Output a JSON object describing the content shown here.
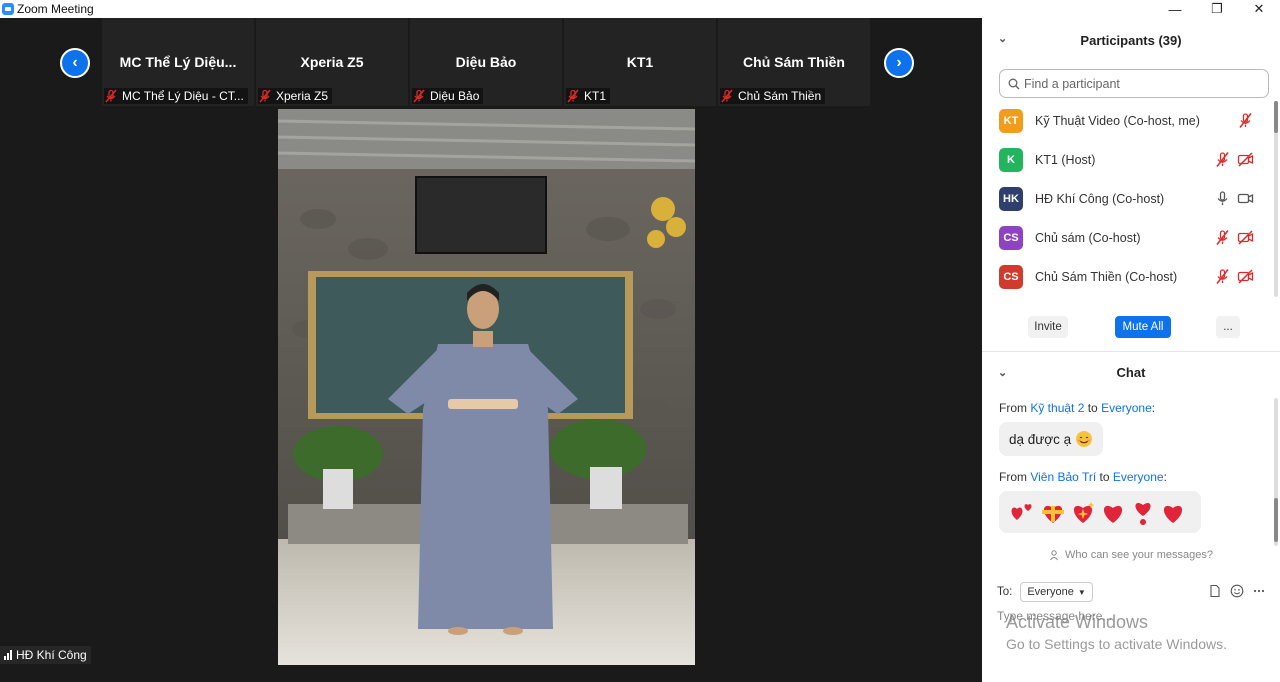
{
  "window": {
    "title": "Zoom Meeting",
    "controls": [
      "—",
      "❐",
      "✕"
    ]
  },
  "thumbnails": [
    {
      "name": "MC Thể Lý Diệu...",
      "label": "MC Thể Lý Diệu - CT..."
    },
    {
      "name": "Xperia Z5",
      "label": "Xperia Z5"
    },
    {
      "name": "Diệu Bảo",
      "label": "Diệu Bảo"
    },
    {
      "name": "KT1",
      "label": "KT1"
    },
    {
      "name": "Chủ Sám Thiền",
      "label": "Chủ Sám Thiền"
    }
  ],
  "nav": {
    "prev": "‹",
    "next": "›"
  },
  "active_speaker": {
    "label": "HĐ Khí Công"
  },
  "participants": {
    "title": "Participants (39)",
    "search_placeholder": "Find a participant",
    "items": [
      {
        "initials": "KT",
        "color": "#f29c1c",
        "name": "Kỹ Thuật Video (Co-host, me)",
        "mic": "off",
        "video": "none"
      },
      {
        "initials": "K",
        "color": "#23b45e",
        "name": "KT1 (Host)",
        "mic": "off",
        "video": "off"
      },
      {
        "initials": "HK",
        "color": "#2e3f6e",
        "name": "HĐ Khí Công (Co-host)",
        "mic": "on",
        "video": "on"
      },
      {
        "initials": "CS",
        "color": "#8e44c2",
        "name": "Chủ sám (Co-host)",
        "mic": "off",
        "video": "off"
      },
      {
        "initials": "CS",
        "color": "#cf3b2c",
        "name": "Chủ Sám Thiền (Co-host)",
        "mic": "off",
        "video": "off"
      }
    ],
    "invite_label": "Invite",
    "mute_all_label": "Mute All",
    "more_label": "..."
  },
  "chat": {
    "title": "Chat",
    "messages": [
      {
        "from_prefix": "From ",
        "sender": "Kỹ thuật 2",
        "to_word": " to ",
        "recipient": "Everyone",
        "suffix": ":",
        "text": "dạ được ạ"
      },
      {
        "from_prefix": "From ",
        "sender": "Viên Bảo Trí",
        "to_word": " to ",
        "recipient": "Everyone",
        "suffix": ":",
        "text": ""
      }
    ],
    "who_can_see": "Who can see your messages?",
    "to_label": "To:",
    "to_value": "Everyone",
    "input_placeholder": "Type message here..."
  },
  "watermark": {
    "line1": "Activate Windows",
    "line2": "Go to Settings to activate Windows."
  },
  "colors": {
    "accent": "#0e72ed",
    "muted_red": "#e02828"
  }
}
